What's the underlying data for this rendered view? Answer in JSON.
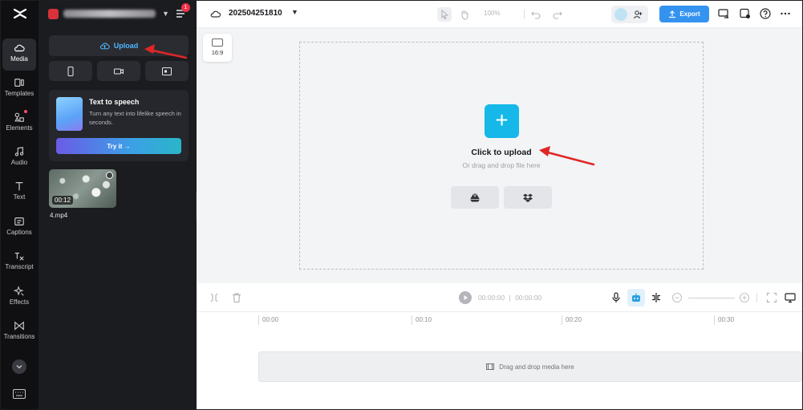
{
  "sidebar": {
    "items": [
      {
        "label": "Media",
        "icon": "cloud-icon",
        "active": true
      },
      {
        "label": "Templates",
        "icon": "templates-icon"
      },
      {
        "label": "Elements",
        "icon": "elements-icon",
        "dot": true
      },
      {
        "label": "Audio",
        "icon": "music-note-icon"
      },
      {
        "label": "Text",
        "icon": "text-icon"
      },
      {
        "label": "Captions",
        "icon": "captions-icon"
      },
      {
        "label": "Transcript",
        "icon": "transcript-icon"
      },
      {
        "label": "Effects",
        "icon": "effects-icon"
      },
      {
        "label": "Transitions",
        "icon": "transitions-icon"
      }
    ]
  },
  "panel": {
    "notification_count": "1",
    "upload_label": "Upload",
    "tts": {
      "title": "Text to speech",
      "description": "Turn any text into lifelike speech in seconds.",
      "button": "Try it →"
    },
    "media": [
      {
        "duration": "00:12",
        "name": "4.mp4"
      }
    ]
  },
  "topbar": {
    "project_name": "202504251810",
    "zoom": "100%",
    "export_label": "Export"
  },
  "canvas": {
    "ratio": "16:9",
    "upload_title": "Click to upload",
    "upload_sub": "Or drag and drop file here"
  },
  "timeline": {
    "current_time": "00:00:00",
    "total_time": "00:00:00",
    "ruler": [
      "00:00",
      "00:10",
      "00:20",
      "00:30"
    ],
    "track_hint": "Drag and drop media here"
  },
  "colors": {
    "accent": "#3593f0",
    "upload_text": "#4fb8ff",
    "plus_button": "#15b8e8",
    "annotation": "#e02626"
  }
}
